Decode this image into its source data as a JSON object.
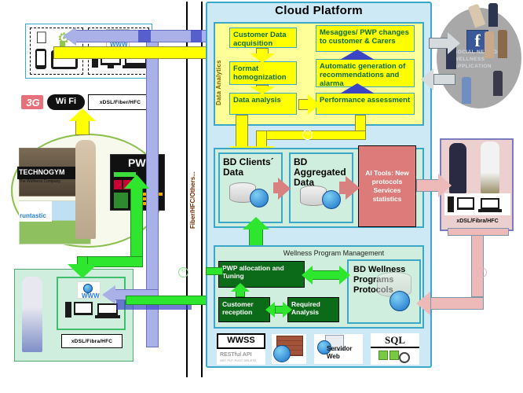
{
  "diagram": {
    "title": "Cloud Platform",
    "vertical_link_label": "Fiber/HFC/Others..."
  },
  "cloud_platform": {
    "title": "Cloud Platform",
    "analytics": {
      "section_label": "Data Analytics",
      "boxes": [
        {
          "id": "customer-data-acquisition",
          "label": "Customer Data acquisition"
        },
        {
          "id": "format-homognization",
          "label": "Format homognization"
        },
        {
          "id": "data-analysis",
          "label": "Data analysis"
        },
        {
          "id": "messages-pwp-changes",
          "label": "Mesagges/ PWP changes to customer & Carers"
        },
        {
          "id": "automatic-generation",
          "label": "Automatic generation of recommendations and alarma"
        },
        {
          "id": "performance-assessment",
          "label": "Performance assessment"
        }
      ]
    },
    "databases": [
      {
        "id": "bd-clients-data",
        "label": "BD Clients´ Data"
      },
      {
        "id": "bd-aggregated-data",
        "label": "BD Aggregated Data"
      }
    ],
    "ai_tools": {
      "label": "AI Tools: New protocols Services statistics"
    },
    "wellness": {
      "title": "Wellness Program Management",
      "boxes": [
        {
          "id": "pwp-allocation-and-tuning",
          "label": "PWP allocation and Tuning"
        },
        {
          "id": "customer-reception",
          "label": "Customer reception"
        },
        {
          "id": "required-analysis",
          "label": "Required Analysis"
        }
      ],
      "database": {
        "id": "bd-wellness",
        "label": "BD Wellness Programs Protocols"
      }
    },
    "services": [
      {
        "id": "wwss",
        "label": "WWSS",
        "sub": "RESTful API",
        "sub2": "GET PUT POST DELETE"
      },
      {
        "id": "firewall",
        "label": ""
      },
      {
        "id": "servidor-web",
        "label": "Servidor Web"
      },
      {
        "id": "sql",
        "label": "SQL"
      }
    ]
  },
  "left_top": {
    "mobile_group_label": "mobile-devices",
    "desktop_group_label": "desktop-devices",
    "www_label": "WWW",
    "access_tags": [
      {
        "id": "3g",
        "label": "3G"
      },
      {
        "id": "wifi",
        "label": "Wi Fi"
      },
      {
        "id": "xdsl",
        "label": "xDSL/Fiber/HFC"
      }
    ]
  },
  "left_middle": {
    "brands": [
      {
        "id": "technogym",
        "label": "TECHNOGYM",
        "tagline": "The Wellness Company"
      },
      {
        "id": "runtastic",
        "label": "runtastic"
      }
    ],
    "terminal": {
      "label": "PWP"
    }
  },
  "left_bottom": {
    "label": "xDSL/Fibra/HFC",
    "www_label": "WWW",
    "role": "nurse"
  },
  "right_top": {
    "social_label": "SOCIAL NETWORK WELLNESS APPLICATION",
    "facebook_glyph": "f"
  },
  "right_middle": {
    "label": "xDSL/Fibra/HFC",
    "role": "doctors"
  },
  "colors": {
    "cloud_bg": "#cce9f5",
    "cloud_border": "#3ba8c9",
    "analytics_bg": "#ffff99",
    "yellow_box": "#ffff00",
    "green_band": "#cfeedd",
    "dark_green_box": "#0b6b18",
    "ai_red": "#dd7b7b",
    "pink_arrow": "#edb9b9",
    "purple_arrow": "#aab0e8",
    "green_arrow": "#2ee62e",
    "yellow_arrow": "#ffff00",
    "gray_arrow": "#d5dadd",
    "doc_panel": "#eccfcf",
    "social_circle": "#a8a8a8"
  }
}
